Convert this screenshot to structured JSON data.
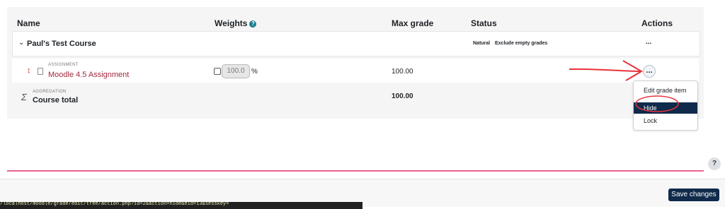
{
  "table": {
    "headers": {
      "name": "Name",
      "weights": "Weights",
      "max_grade": "Max grade",
      "status": "Status",
      "actions": "Actions"
    },
    "weights_help_icon": "question-icon",
    "course": {
      "name": "Paul's Test Course",
      "status_natural": "Natural",
      "status_exclude": "Exclude empty grades",
      "actions_label": "..."
    },
    "assignment": {
      "type_label": "ASSIGNMENT",
      "name": "Moodle 4.5 Assignment",
      "weight_value": "100.0",
      "weight_unit": "%",
      "max_grade": "100.00",
      "actions_label": "..."
    },
    "total": {
      "type_label": "AGGREGATION",
      "name": "Course total",
      "max_grade": "100.00",
      "symbol": "Σ"
    }
  },
  "action_menu": {
    "items": [
      "Edit grade item",
      "Hide",
      "Lock"
    ],
    "active_item": "Hide"
  },
  "footer": {
    "save_label": "Save changes",
    "help_label": "?"
  },
  "statusbar_text": "/localhost/moodle/grade/edit/tree/action.php?id=2&action=hide&eid=i3&sesskey=",
  "colors": {
    "accent": "#0f2a4a",
    "link": "#a12a3e",
    "annotation": "#e8323c"
  }
}
